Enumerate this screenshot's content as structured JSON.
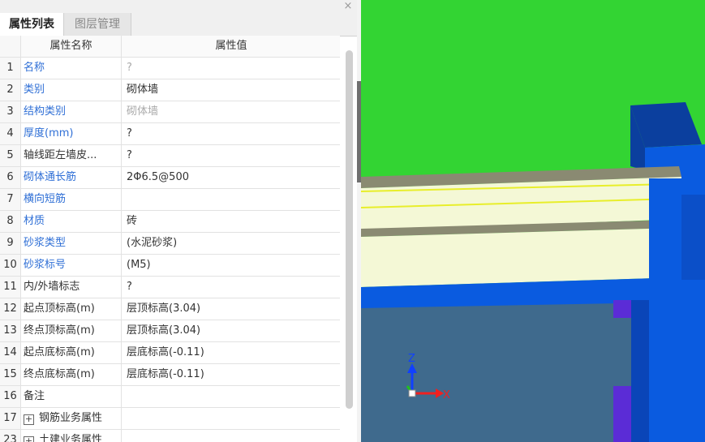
{
  "panel": {
    "close_symbol": "×",
    "tabs": [
      {
        "label": "属性列表",
        "active": true
      },
      {
        "label": "图层管理",
        "active": false
      }
    ],
    "columns": {
      "name": "属性名称",
      "value": "属性值"
    }
  },
  "rows": [
    {
      "num": "1",
      "name": "名称",
      "value": "?",
      "name_color": "blue",
      "value_color": "gray"
    },
    {
      "num": "2",
      "name": "类别",
      "value": "砌体墙",
      "name_color": "blue",
      "value_color": "dark"
    },
    {
      "num": "3",
      "name": "结构类别",
      "value": "砌体墙",
      "name_color": "blue",
      "value_color": "gray"
    },
    {
      "num": "4",
      "name": "厚度(mm)",
      "value": "?",
      "name_color": "blue",
      "value_color": "dark"
    },
    {
      "num": "5",
      "name": "轴线距左墙皮...",
      "value": "?",
      "name_color": "dark",
      "value_color": "dark"
    },
    {
      "num": "6",
      "name": "砌体通长筋",
      "value": "2Φ6.5@500",
      "name_color": "blue",
      "value_color": "dark"
    },
    {
      "num": "7",
      "name": "横向短筋",
      "value": "",
      "name_color": "blue",
      "value_color": "dark"
    },
    {
      "num": "8",
      "name": "材质",
      "value": "砖",
      "name_color": "blue",
      "value_color": "dark"
    },
    {
      "num": "9",
      "name": "砂浆类型",
      "value": "(水泥砂浆)",
      "name_color": "blue",
      "value_color": "dark"
    },
    {
      "num": "10",
      "name": "砂浆标号",
      "value": "(M5)",
      "name_color": "blue",
      "value_color": "dark"
    },
    {
      "num": "11",
      "name": "内/外墙标志",
      "value": "?",
      "name_color": "dark",
      "value_color": "dark"
    },
    {
      "num": "12",
      "name": "起点顶标高(m)",
      "value": "层顶标高(3.04)",
      "name_color": "dark",
      "value_color": "dark"
    },
    {
      "num": "13",
      "name": "终点顶标高(m)",
      "value": "层顶标高(3.04)",
      "name_color": "dark",
      "value_color": "dark"
    },
    {
      "num": "14",
      "name": "起点底标高(m)",
      "value": "层底标高(-0.11)",
      "name_color": "dark",
      "value_color": "dark"
    },
    {
      "num": "15",
      "name": "终点底标高(m)",
      "value": "层底标高(-0.11)",
      "name_color": "dark",
      "value_color": "dark"
    },
    {
      "num": "16",
      "name": "备注",
      "value": "",
      "name_color": "dark",
      "value_color": "dark"
    },
    {
      "num": "17",
      "name": "钢筋业务属性",
      "value": "",
      "name_color": "dark",
      "value_color": "dark",
      "expandable": true
    },
    {
      "num": "23",
      "name": "土建业务属性",
      "value": "",
      "name_color": "dark",
      "value_color": "dark",
      "expandable": true
    }
  ],
  "viewport": {
    "axis_z_label": "Z",
    "axis_x_label": "X",
    "colors": {
      "sky": "#33d433",
      "floor": "#3f6a8d",
      "blue_block": "#0a5be0",
      "dark_blue": "#0b3f9e",
      "wall_light": "#f4f8d6",
      "wall_gray": "#8a8a72",
      "rebar": "#e8ee2a",
      "purple": "#5b2cd6"
    }
  }
}
